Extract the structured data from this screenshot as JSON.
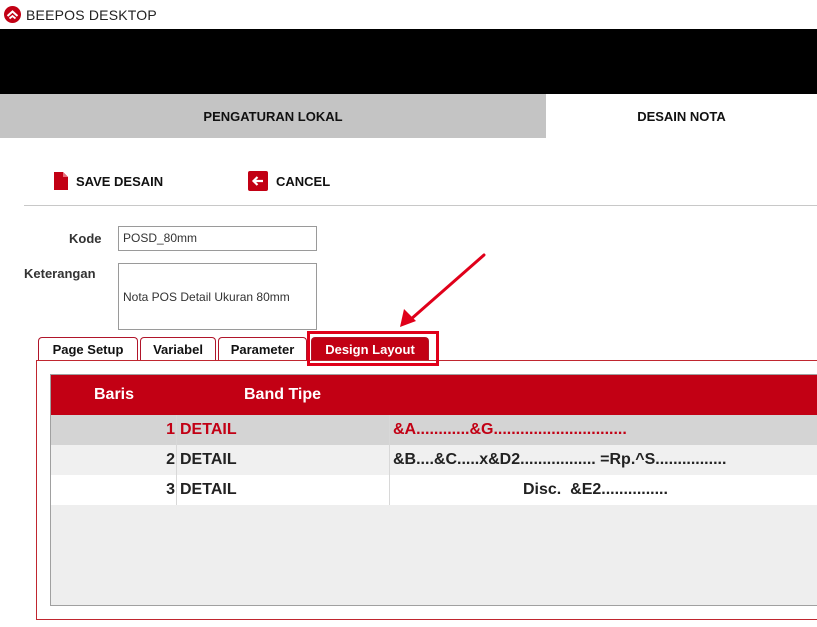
{
  "app": {
    "title": "BEEPOS DESKTOP",
    "logo_icon": "beepos-logo-icon",
    "accent": "#c20014"
  },
  "main_tabs": [
    {
      "label": "PENGATURAN LOKAL",
      "active": false
    },
    {
      "label": "DESAIN NOTA",
      "active": true
    }
  ],
  "toolbar": {
    "save_label": "SAVE DESAIN",
    "save_icon": "document-icon",
    "cancel_label": "CANCEL",
    "cancel_icon": "back-arrow-icon"
  },
  "form": {
    "kode_label": "Kode",
    "kode_value": "POSD_80mm",
    "keterangan_label": "Keterangan",
    "keterangan_value": "Nota POS Detail Ukuran 80mm"
  },
  "sub_tabs": [
    {
      "label": "Page Setup",
      "active": false
    },
    {
      "label": "Variabel",
      "active": false
    },
    {
      "label": "Parameter",
      "active": false
    },
    {
      "label": "Design Layout",
      "active": true
    }
  ],
  "grid": {
    "columns": [
      "Baris",
      "Band Tipe"
    ],
    "rows": [
      {
        "baris": "1",
        "band": "DETAIL",
        "layout": "&A............&G.............................."
      },
      {
        "baris": "2",
        "band": "DETAIL",
        "layout": "&B....&C.....x&D2................. =Rp.^S................"
      },
      {
        "baris": "3",
        "band": "DETAIL",
        "layout": "Disc.  &E2..............."
      }
    ]
  },
  "annotation": {
    "color": "#e0001a"
  }
}
